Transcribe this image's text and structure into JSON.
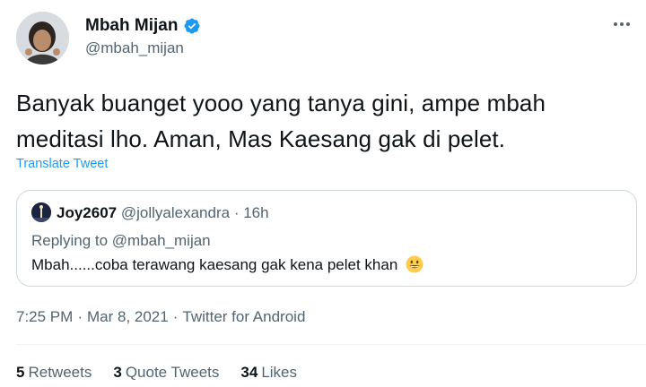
{
  "author": {
    "display_name": "Mbah Mijan",
    "handle": "@mbah_mijan",
    "verified": true,
    "verified_color": "#1d9bf0"
  },
  "tweet": {
    "text": "Banyak buanget yooo yang tanya gini, ampe mbah\nmeditasi lho. Aman, Mas Kaesang gak di pelet.",
    "translate_label": "Translate Tweet"
  },
  "quoted": {
    "display_name": "Joy2607",
    "handle": "@jollyalexandra",
    "separator": "·",
    "age": "16h",
    "replying_to": "Replying to @mbah_mijan",
    "text": "Mbah......coba terawang kaesang gak kena pelet khan",
    "emoji": "grinning-face-emoji"
  },
  "meta": {
    "time": "7:25 PM",
    "date": "Mar 8, 2021",
    "source": "Twitter for Android",
    "separator": "·"
  },
  "stats": {
    "retweets_count": "5",
    "retweets_label": "Retweets",
    "quotes_count": "3",
    "quotes_label": "Quote Tweets",
    "likes_count": "34",
    "likes_label": "Likes"
  },
  "colors": {
    "link": "#1d9bf0",
    "muted": "#536471",
    "text": "#0f1419",
    "border": "#cfd9de"
  },
  "icons": {
    "more": "more-horizontal-icon",
    "verified": "verified-badge-icon"
  }
}
